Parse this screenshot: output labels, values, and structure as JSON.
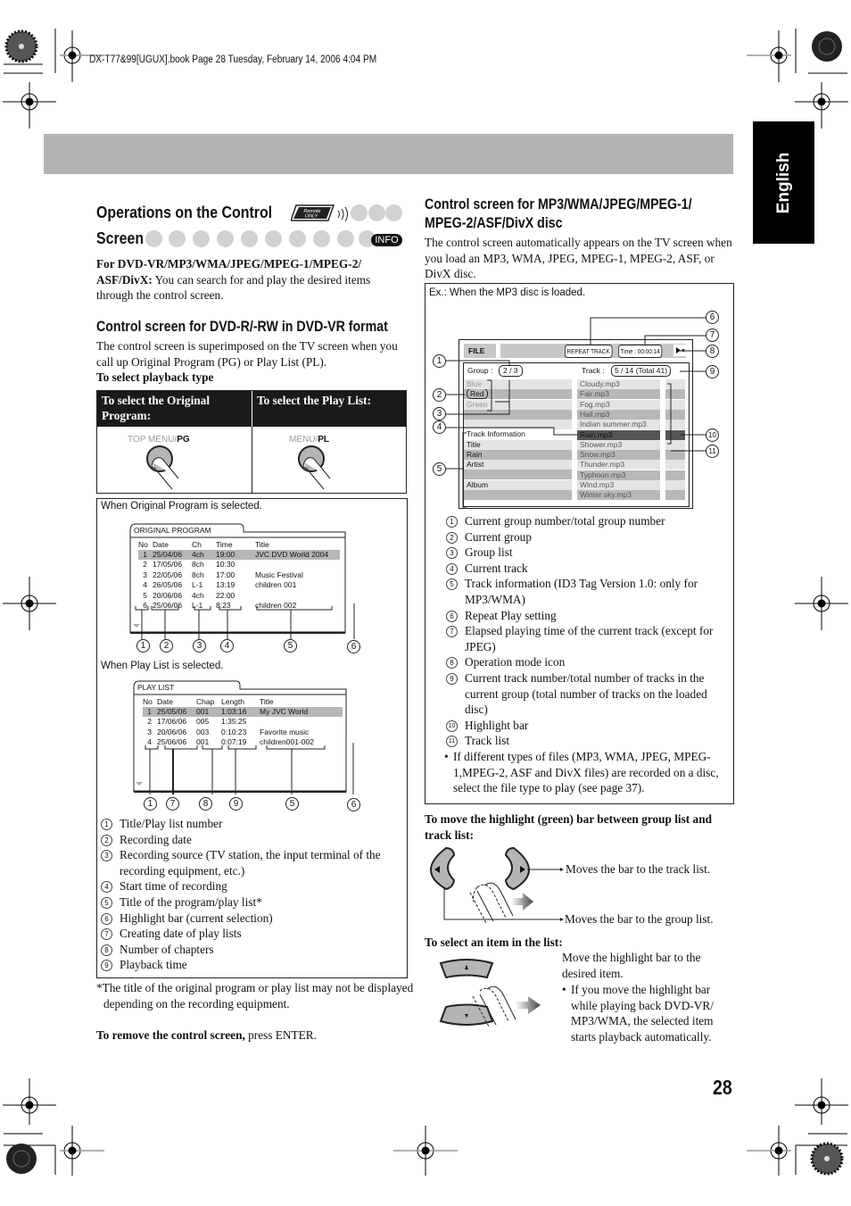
{
  "file_header": "DX-T77&99[UGUX].book  Page 28  Tuesday, February 14, 2006  4:04 PM",
  "language_tab": "English",
  "page_number": "28",
  "left": {
    "title_line1": "Operations on the Control",
    "title_line2": "Screen",
    "remote_badge": "Remote ONLY",
    "info_badge": "INFO",
    "intro_bold": "For DVD-VR/MP3/WMA/JPEG/MPEG-1/MPEG-2/ ASF/DivX:",
    "intro_rest": " You can search for and play the desired items through the control screen.",
    "subheading": "Control screen for DVD-R/-RW in DVD-VR format",
    "sub_text": "The control screen is superimposed on the TV screen when you call up Original Program (PG) or Play List (PL).",
    "select_heading": "To select playback type",
    "table": {
      "col1_header": "To select the Original Program:",
      "col2_header": "To select the Play List:",
      "col1_button_gray": "TOP MENU/",
      "col1_button_bold": "PG",
      "col2_button_gray": "MENU/",
      "col2_button_bold": "PL"
    },
    "original_caption": "When Original Program is selected.",
    "original_screen": {
      "tab_label": "ORIGINAL PROGRAM",
      "headers": [
        "No",
        "Date",
        "Ch",
        "Time",
        "Title"
      ],
      "rows": [
        [
          "1",
          "25/04/06",
          "4ch",
          "19:00",
          "JVC DVD World 2004"
        ],
        [
          "2",
          "17/05/06",
          "8ch",
          "10:30",
          ""
        ],
        [
          "3",
          "22/05/06",
          "8ch",
          "17:00",
          "Music Festival"
        ],
        [
          "4",
          "26/05/06",
          "L-1",
          "13:19",
          "children 001"
        ],
        [
          "5",
          "20/06/06",
          "4ch",
          "22:00",
          ""
        ],
        [
          "6",
          "25/06/06",
          "L-1",
          "8:23",
          "children 002"
        ]
      ],
      "callouts": [
        "1",
        "2",
        "3",
        "4",
        "5",
        "6"
      ]
    },
    "playlist_caption": "When Play List is selected.",
    "playlist_screen": {
      "tab_label": "PLAY LIST",
      "headers": [
        "No",
        "Date",
        "Chap",
        "Length",
        "Title"
      ],
      "rows": [
        [
          "1",
          "25/05/06",
          "001",
          "1:03:16",
          "My JVC World"
        ],
        [
          "2",
          "17/06/06",
          "005",
          "1:35:25",
          ""
        ],
        [
          "3",
          "20/06/06",
          "003",
          "0:10:23",
          "Favorite music"
        ],
        [
          "4",
          "25/06/06",
          "001",
          "0:07:19",
          "children001-002"
        ]
      ],
      "callouts": [
        "1",
        "7",
        "8",
        "9",
        "5",
        "6"
      ]
    },
    "legend": [
      {
        "num": "1",
        "text": "Title/Play list number"
      },
      {
        "num": "2",
        "text": "Recording date"
      },
      {
        "num": "3",
        "text": "Recording source (TV station, the input terminal of the recording equipment, etc.)"
      },
      {
        "num": "4",
        "text": "Start time of recording"
      },
      {
        "num": "5",
        "text": "Title of the program/play list*"
      },
      {
        "num": "6",
        "text": "Highlight bar (current selection)"
      },
      {
        "num": "7",
        "text": "Creating date of play lists"
      },
      {
        "num": "8",
        "text": "Number of chapters"
      },
      {
        "num": "9",
        "text": "Playback time"
      }
    ],
    "footnote": "*The title of the original program or play list may not be displayed depending on the recording equipment.",
    "remove_bold": "To remove the control screen,",
    "remove_rest": " press ENTER."
  },
  "right": {
    "heading_line1": "Control screen for MP3/WMA/JPEG/MPEG-1/",
    "heading_line2": "MPEG-2/ASF/DivX disc",
    "intro": "The control screen automatically appears on the TV screen when you load an MP3, WMA, JPEG, MPEG-1, MPEG-2, ASF, or DivX disc.",
    "example_caption": "Ex.: When the MP3 disc is loaded.",
    "mp3_screen": {
      "file_label": "FILE",
      "repeat": "REPEAT TRACK",
      "time": "Time :  00:00:14",
      "mode_icon": "play-mode",
      "group_label": "Group :",
      "group_value": "2 / 3",
      "track_label": "Track :",
      "track_value": "5 / 14 (Total 41)",
      "groups": [
        "Blue",
        "Red",
        "Green"
      ],
      "track_info_header": "Track Information",
      "track_info": [
        "Title",
        "Rain",
        "Artist",
        "",
        "Album",
        ""
      ],
      "tracks": [
        "Cloudy.mp3",
        "Fair.mp3",
        "Fog.mp3",
        "Hail.mp3",
        "Indian summer.mp3",
        "Rain.mp3",
        "Shower.mp3",
        "Snow.mp3",
        "Thunder.mp3",
        "Typhoon.mp3",
        "Wind.mp3",
        "Winter sky.mp3"
      ],
      "current_track_index": 5
    },
    "legend": [
      {
        "num": "1",
        "text": "Current group number/total group number"
      },
      {
        "num": "2",
        "text": "Current group"
      },
      {
        "num": "3",
        "text": "Group list"
      },
      {
        "num": "4",
        "text": "Current track"
      },
      {
        "num": "5",
        "text": "Track information (ID3 Tag Version 1.0: only for MP3/WMA)"
      },
      {
        "num": "6",
        "text": "Repeat Play setting"
      },
      {
        "num": "7",
        "text": "Elapsed playing time of the current track (except for JPEG)"
      },
      {
        "num": "8",
        "text": "Operation mode icon"
      },
      {
        "num": "9",
        "text": "Current track number/total number of tracks in the current group (total number of tracks on the loaded disc)"
      },
      {
        "num": "10",
        "text": "Highlight bar"
      },
      {
        "num": "11",
        "text": "Track list"
      }
    ],
    "bullet": "If different types of files (MP3, WMA, JPEG, MPEG-1,MPEG-2, ASF and DivX files) are recorded on a disc, select the file type to play (see page 37).",
    "move_heading": "To move the highlight (green) bar between group list and track list:",
    "move_right": "Moves the bar to the track list.",
    "move_left": "Moves the bar to the group list.",
    "select_heading": "To select an item in the list:",
    "select_text": "Move the highlight bar to the desired item.",
    "select_bullet": "If you move the highlight bar while playing back DVD-VR/ MP3/WMA, the selected item starts playback automatically."
  }
}
